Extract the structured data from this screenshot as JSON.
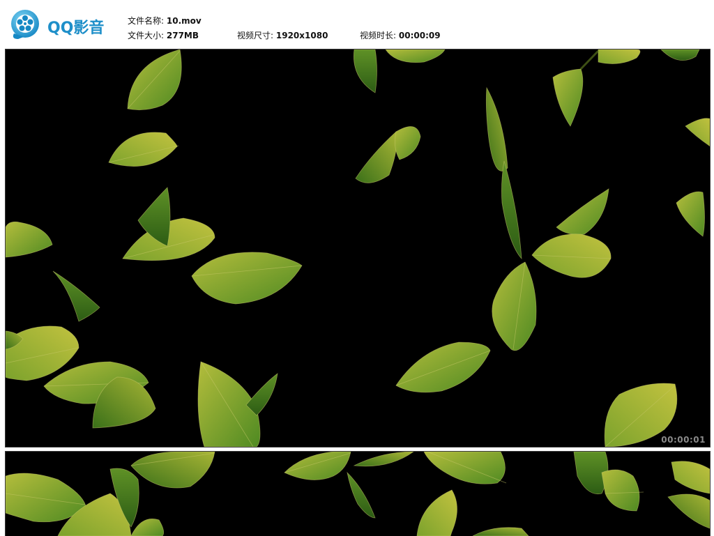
{
  "app": {
    "logo_text": "QQ影音"
  },
  "file_info": {
    "name_label": "文件名称:",
    "name_value": "10.mov",
    "size_label": "文件大小:",
    "size_value": "277MB",
    "dimension_label": "视频尺寸:",
    "dimension_value": "1920x1080",
    "duration_label": "视频时长:",
    "duration_value": "00:00:09"
  },
  "frames": [
    {
      "timecode": "00:00:01"
    },
    {
      "timecode": ""
    }
  ],
  "colors": {
    "brand_blue": "#1e8fc9",
    "leaf_light": "#a9b83a",
    "leaf_dark": "#3f7a1f",
    "frame_bg": "#000000"
  }
}
